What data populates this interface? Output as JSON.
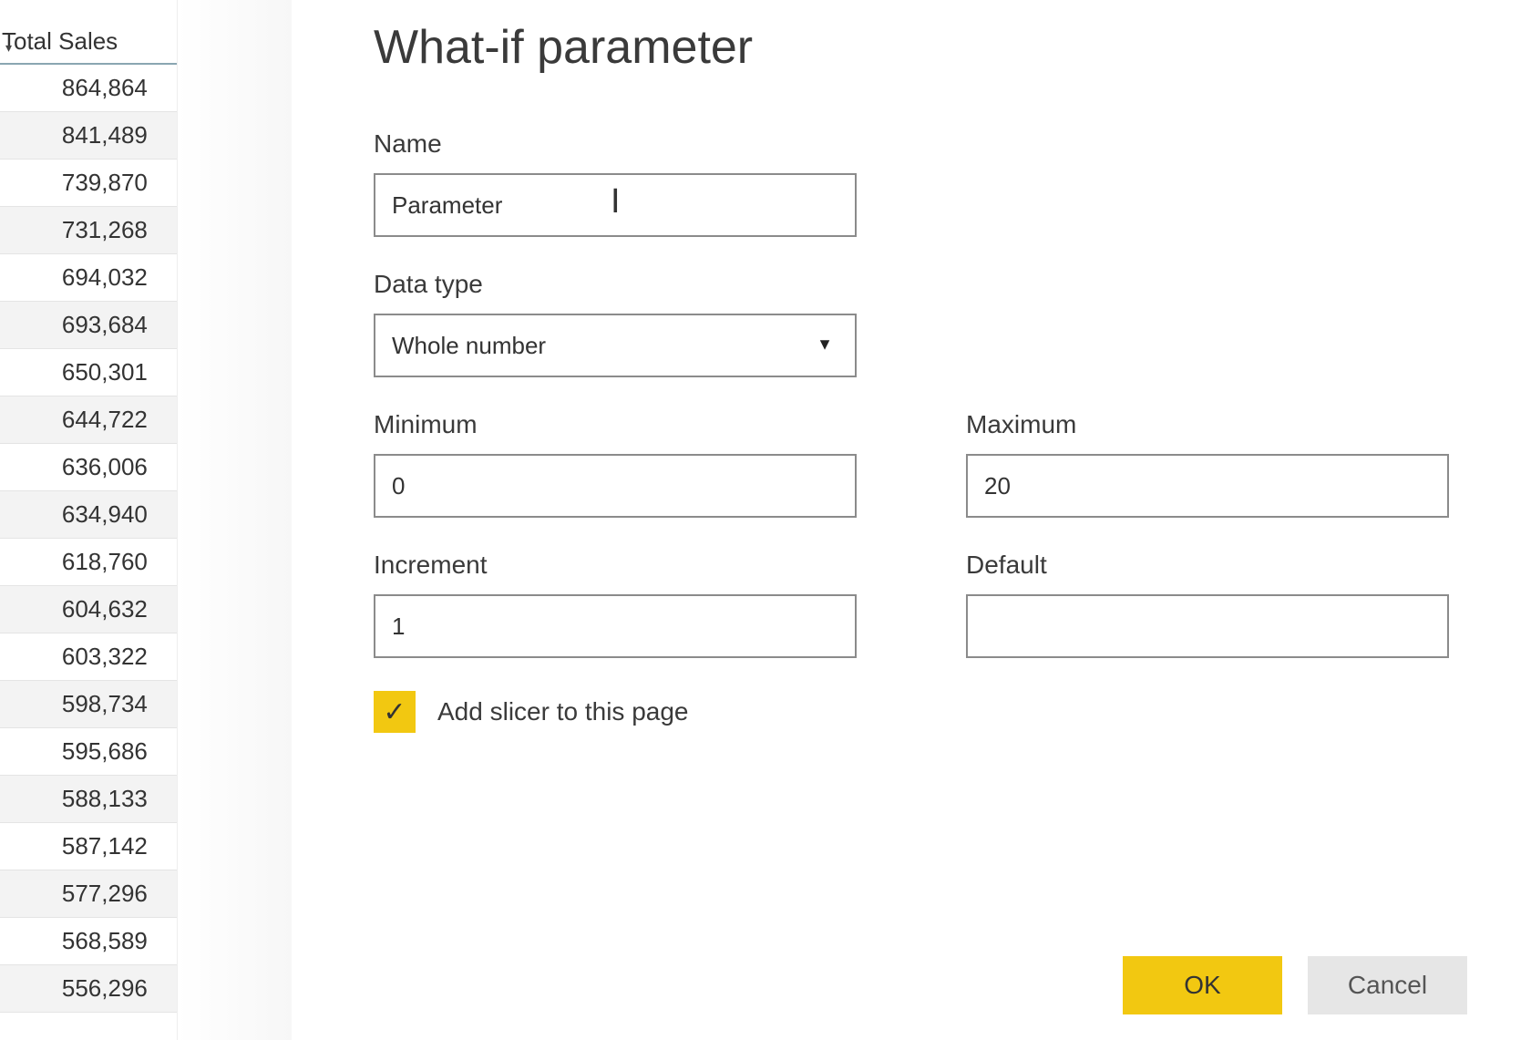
{
  "table": {
    "header": "Total Sales",
    "sort_caret": "▾",
    "rows": [
      "864,864",
      "841,489",
      "739,870",
      "731,268",
      "694,032",
      "693,684",
      "650,301",
      "644,722",
      "636,006",
      "634,940",
      "618,760",
      "604,632",
      "603,322",
      "598,734",
      "595,686",
      "588,133",
      "587,142",
      "577,296",
      "568,589",
      "556,296"
    ]
  },
  "dialog": {
    "title": "What-if parameter",
    "name_label": "Name",
    "name_value": "Parameter",
    "data_type_label": "Data type",
    "data_type_value": "Whole number",
    "select_caret": "▼",
    "minimum_label": "Minimum",
    "minimum_value": "0",
    "maximum_label": "Maximum",
    "maximum_value": "20",
    "increment_label": "Increment",
    "increment_value": "1",
    "default_label": "Default",
    "default_value": "",
    "checkbox_check": "✓",
    "checkbox_label": "Add slicer to this page",
    "ok_label": "OK",
    "cancel_label": "Cancel"
  }
}
